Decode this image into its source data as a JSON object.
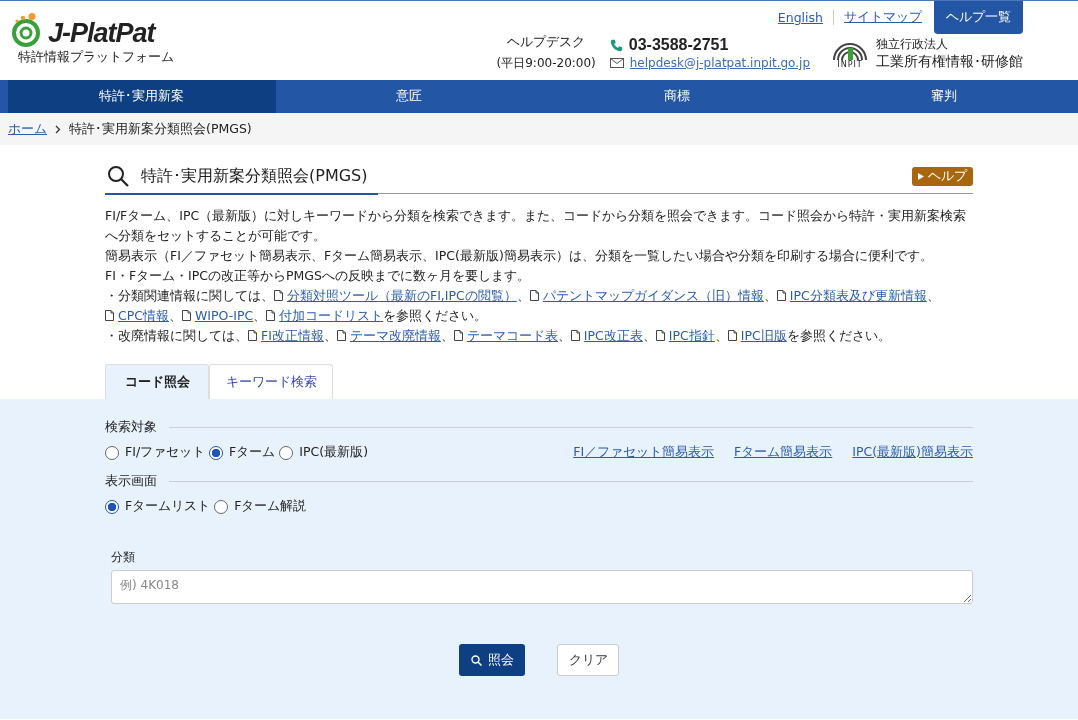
{
  "header": {
    "logo_text": "J-PlatPat",
    "logo_subtitle": "特許情報プラットフォーム",
    "helpdesk_label": "ヘルプデスク",
    "helpdesk_hours": "(平日9:00-20:00)",
    "phone": "03-3588-2751",
    "email": "helpdesk@j-platpat.inpit.go.jp",
    "top_links": [
      "English",
      "サイトマップ"
    ],
    "help_button": "ヘルプ一覧",
    "org_mark": "INPIT",
    "org_type": "独立行政法人",
    "org_name": "工業所有権情報･研修館"
  },
  "nav": [
    {
      "label": "特許･実用新案",
      "selected": true
    },
    {
      "label": "意匠",
      "selected": false
    },
    {
      "label": "商標",
      "selected": false
    },
    {
      "label": "審判",
      "selected": false
    }
  ],
  "breadcrumb": [
    {
      "label": "ホーム",
      "kind": "link"
    },
    {
      "label": "特許･実用新案分類照会(PMGS)",
      "kind": "current"
    }
  ],
  "page_title": "特許･実用新案分類照会(PMGS)",
  "help_badge": "ヘルプ",
  "intro": [
    {
      "parts": [
        {
          "kind": "text",
          "text": "FI/Fターム、IPC（最新版）に対しキーワードから分類を検索できます。また、コードから分類を照会できます。コード照会から特許・実用新案検索へ分類をセットすることが可能です。"
        }
      ]
    },
    {
      "parts": [
        {
          "kind": "text",
          "text": "簡易表示（FI／ファセット簡易表示、Fターム簡易表示、IPC(最新版)簡易表示）は、分類を一覧したい場合や分類を印刷する場合に便利です。"
        }
      ]
    },
    {
      "parts": [
        {
          "kind": "text",
          "text": "FI・Fターム・IPCの改正等からPMGSへの反映までに数ヶ月を要します。"
        }
      ]
    },
    {
      "parts": [
        {
          "kind": "text",
          "text": "・分類関連情報に関しては、"
        },
        {
          "kind": "link",
          "text": "分類対照ツール（最新のFI,IPCの閲覧）"
        },
        {
          "kind": "text",
          "text": "、"
        },
        {
          "kind": "link",
          "text": "パテントマップガイダンス（旧）情報"
        },
        {
          "kind": "text",
          "text": "、"
        },
        {
          "kind": "link",
          "text": "IPC分類表及び更新情報"
        },
        {
          "kind": "text",
          "text": "、"
        },
        {
          "kind": "link",
          "text": "CPC情報"
        },
        {
          "kind": "text",
          "text": "、"
        },
        {
          "kind": "link",
          "text": "WIPO-IPC"
        },
        {
          "kind": "text",
          "text": "、"
        },
        {
          "kind": "link",
          "text": "付加コードリスト"
        },
        {
          "kind": "text",
          "text": "を参照ください。"
        }
      ]
    },
    {
      "parts": [
        {
          "kind": "text",
          "text": "・改廃情報に関しては、"
        },
        {
          "kind": "link",
          "text": "FI改正情報"
        },
        {
          "kind": "text",
          "text": "、"
        },
        {
          "kind": "link",
          "text": "テーマ改廃情報"
        },
        {
          "kind": "text",
          "text": "、"
        },
        {
          "kind": "link",
          "text": "テーマコード表"
        },
        {
          "kind": "text",
          "text": "、"
        },
        {
          "kind": "link",
          "text": "IPC改正表"
        },
        {
          "kind": "text",
          "text": "、"
        },
        {
          "kind": "link",
          "text": "IPC指針"
        },
        {
          "kind": "text",
          "text": "、"
        },
        {
          "kind": "link",
          "text": "IPC旧版"
        },
        {
          "kind": "text",
          "text": "を参照ください。"
        }
      ]
    }
  ],
  "tabs": [
    {
      "label": "コード照会",
      "selected": true
    },
    {
      "label": "キーワード検索",
      "selected": false
    }
  ],
  "search_target": {
    "label": "検索対象",
    "options": [
      {
        "label": "FI/ファセット",
        "selected": false
      },
      {
        "label": "Fターム",
        "selected": true
      },
      {
        "label": "IPC(最新版)",
        "selected": false
      }
    ],
    "links": [
      "FI／ファセット簡易表示",
      "Fターム簡易表示",
      "IPC(最新版)簡易表示"
    ]
  },
  "display_screen": {
    "label": "表示画面",
    "options": [
      {
        "label": "Fタームリスト",
        "selected": true
      },
      {
        "label": "Fターム解説",
        "selected": false
      }
    ]
  },
  "classification": {
    "label": "分類",
    "placeholder": "例) 4K018"
  },
  "buttons": [
    {
      "label": "照会",
      "kind": "primary"
    },
    {
      "label": "クリア",
      "kind": "secondary"
    }
  ]
}
